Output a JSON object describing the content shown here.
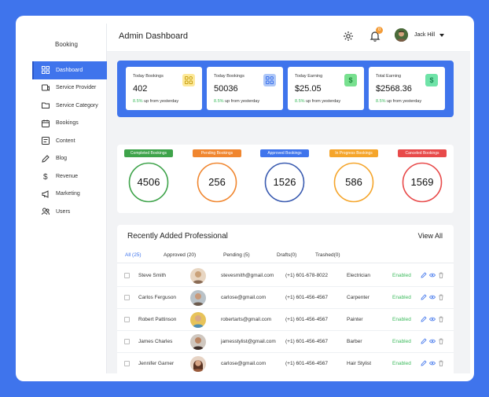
{
  "brand": "Booking",
  "sidebar": {
    "items": [
      {
        "label": "Dashboard",
        "icon": "dashboard-icon",
        "active": true
      },
      {
        "label": "Service Provider",
        "icon": "service-provider-icon"
      },
      {
        "label": "Service Category",
        "icon": "folder-icon"
      },
      {
        "label": "Bookings",
        "icon": "calendar-icon"
      },
      {
        "label": "Content",
        "icon": "content-icon"
      },
      {
        "label": "Blog",
        "icon": "edit-icon"
      },
      {
        "label": "Revenue",
        "icon": "dollar-icon"
      },
      {
        "label": "Marketing",
        "icon": "megaphone-icon"
      },
      {
        "label": "Users",
        "icon": "users-icon"
      }
    ]
  },
  "header": {
    "title": "Admin Dashboard",
    "notification_count": "0",
    "user_name": "Jack Hill"
  },
  "stats": [
    {
      "label": "Today Bookings",
      "value": "402",
      "delta": "8.5%",
      "delta_text": " up from yesterday",
      "icon": "grid-icon",
      "icon_bg": "#fde99a",
      "icon_color": "#c9a216"
    },
    {
      "label": "Today Bookings",
      "value": "50036",
      "delta": "8.5%",
      "delta_text": " up from yesterday",
      "icon": "grid-icon",
      "icon_bg": "#aec7f7",
      "icon_color": "#3f74ec"
    },
    {
      "label": "Today Earning",
      "value": "$25.05",
      "delta": "8.5%",
      "delta_text": " up from yesterday",
      "icon": "dollar-icon",
      "icon_bg": "#78e08f",
      "icon_color": "#1f8a3d"
    },
    {
      "label": "Total Earning",
      "value": "$2568.36",
      "delta": "8.5%",
      "delta_text": " up from yesterday",
      "icon": "dollar-icon",
      "icon_bg": "#6fe3a8",
      "icon_color": "#1b8a55"
    }
  ],
  "rings": [
    {
      "label": "Completed Bookings",
      "value": "4506",
      "color": "#3ea34a"
    },
    {
      "label": "Pending Bookings",
      "value": "256",
      "color": "#f0862f"
    },
    {
      "label": "Approved Bookings",
      "value": "1526",
      "color": "#3f74ec"
    },
    {
      "label": "In Progress Bookings",
      "value": "586",
      "color": "#f5a52b"
    },
    {
      "label": "Canceled Bookings",
      "value": "1569",
      "color": "#e84a4a"
    }
  ],
  "table": {
    "title": "Recently Added Professional",
    "view_all": "View All",
    "tabs": [
      {
        "label": "All (25)",
        "active": true
      },
      {
        "label": "Approved (20)"
      },
      {
        "label": "Pending (5)"
      },
      {
        "label": "Drafts(0)"
      },
      {
        "label": "Trashed(0)"
      }
    ],
    "rows": [
      {
        "name": "Steve Smith",
        "email": "stevesmith@gmail.com",
        "phone": "(+1) 601-678-8022",
        "role": "Electrician",
        "status": "Enabled",
        "avatar_color": "#caa27a"
      },
      {
        "name": "Carlos Ferguson",
        "email": "carlose@gmail.com",
        "phone": "(+1) 601-456-4567",
        "role": "Carpenter",
        "status": "Enabled",
        "avatar_color": "#6c5b4e"
      },
      {
        "name": "Robert Pattinson",
        "email": "robertarts@gmail.com",
        "phone": "(+1) 601-456-4567",
        "role": "Painter",
        "status": "Enabled",
        "avatar_color": "#4f8fb3"
      },
      {
        "name": "James Charles",
        "email": "jamesstylist@gmail.com",
        "phone": "(+1) 601-456-4567",
        "role": "Barber",
        "status": "Enabled",
        "avatar_color": "#3d2e28"
      },
      {
        "name": "Jennifer Garner",
        "email": "carlose@gmail.com",
        "phone": "(+1) 601-456-4567",
        "role": "Hair Stylist",
        "status": "Enabled",
        "avatar_color": "#9a5b3c"
      }
    ]
  }
}
